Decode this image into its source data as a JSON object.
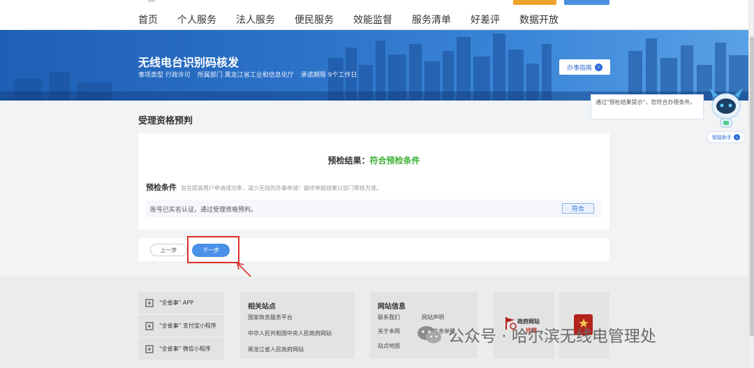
{
  "nav": {
    "items": [
      "首页",
      "个人服务",
      "法人服务",
      "便民服务",
      "效能监督",
      "服务清单",
      "好差评",
      "数据开放"
    ]
  },
  "banner": {
    "title": "无线电台识别码核发",
    "meta": {
      "type": "事项类型  行政许可",
      "dept": "所属部门  黑龙江省工业和信息化厅",
      "deadline": "承诺期限  9个工作日"
    },
    "guide_button": "办事指南"
  },
  "section": {
    "title": "受理资格预判"
  },
  "precheck": {
    "result_label": "预检结果：",
    "result_value": "符合预检条件",
    "condition_label": "预检条件",
    "condition_desc": "旨在提高用户申请成功率，减少无效的办事申请！最终申报结果以部门审核为准。",
    "condition_row_text": "账号已实名认证，通过受理资格预判。",
    "condition_row_tag": "符合"
  },
  "actions": {
    "prev": "上一步",
    "next": "下一步"
  },
  "assistant": {
    "bubble_text": "通过\"预检结果提示\"，您符合办理条件。",
    "button": "智能助手"
  },
  "footer": {
    "apps": [
      "\"全省事\" APP",
      "\"全省事\" 支付宝小程序",
      "\"全省事\" 微信小程序"
    ],
    "related": {
      "title": "相关站点",
      "links": [
        "国家政务服务平台",
        "中华人民共和国中央人民政府网站",
        "黑龙江省人民政府网站"
      ]
    },
    "siteinfo": {
      "title": "网站信息",
      "links": [
        "联系我们",
        "网站声明",
        "关于本网",
        "不良信息举报",
        "站点地图"
      ]
    },
    "gov_site": {
      "line1": "政府网站",
      "line2": "找错"
    },
    "watermark": "公众号 · 哈尔滨无线电管理处"
  },
  "colors": {
    "accent_blue": "#4a8fe8",
    "success_green": "#3cb035",
    "highlight_red": "#e02e24"
  }
}
